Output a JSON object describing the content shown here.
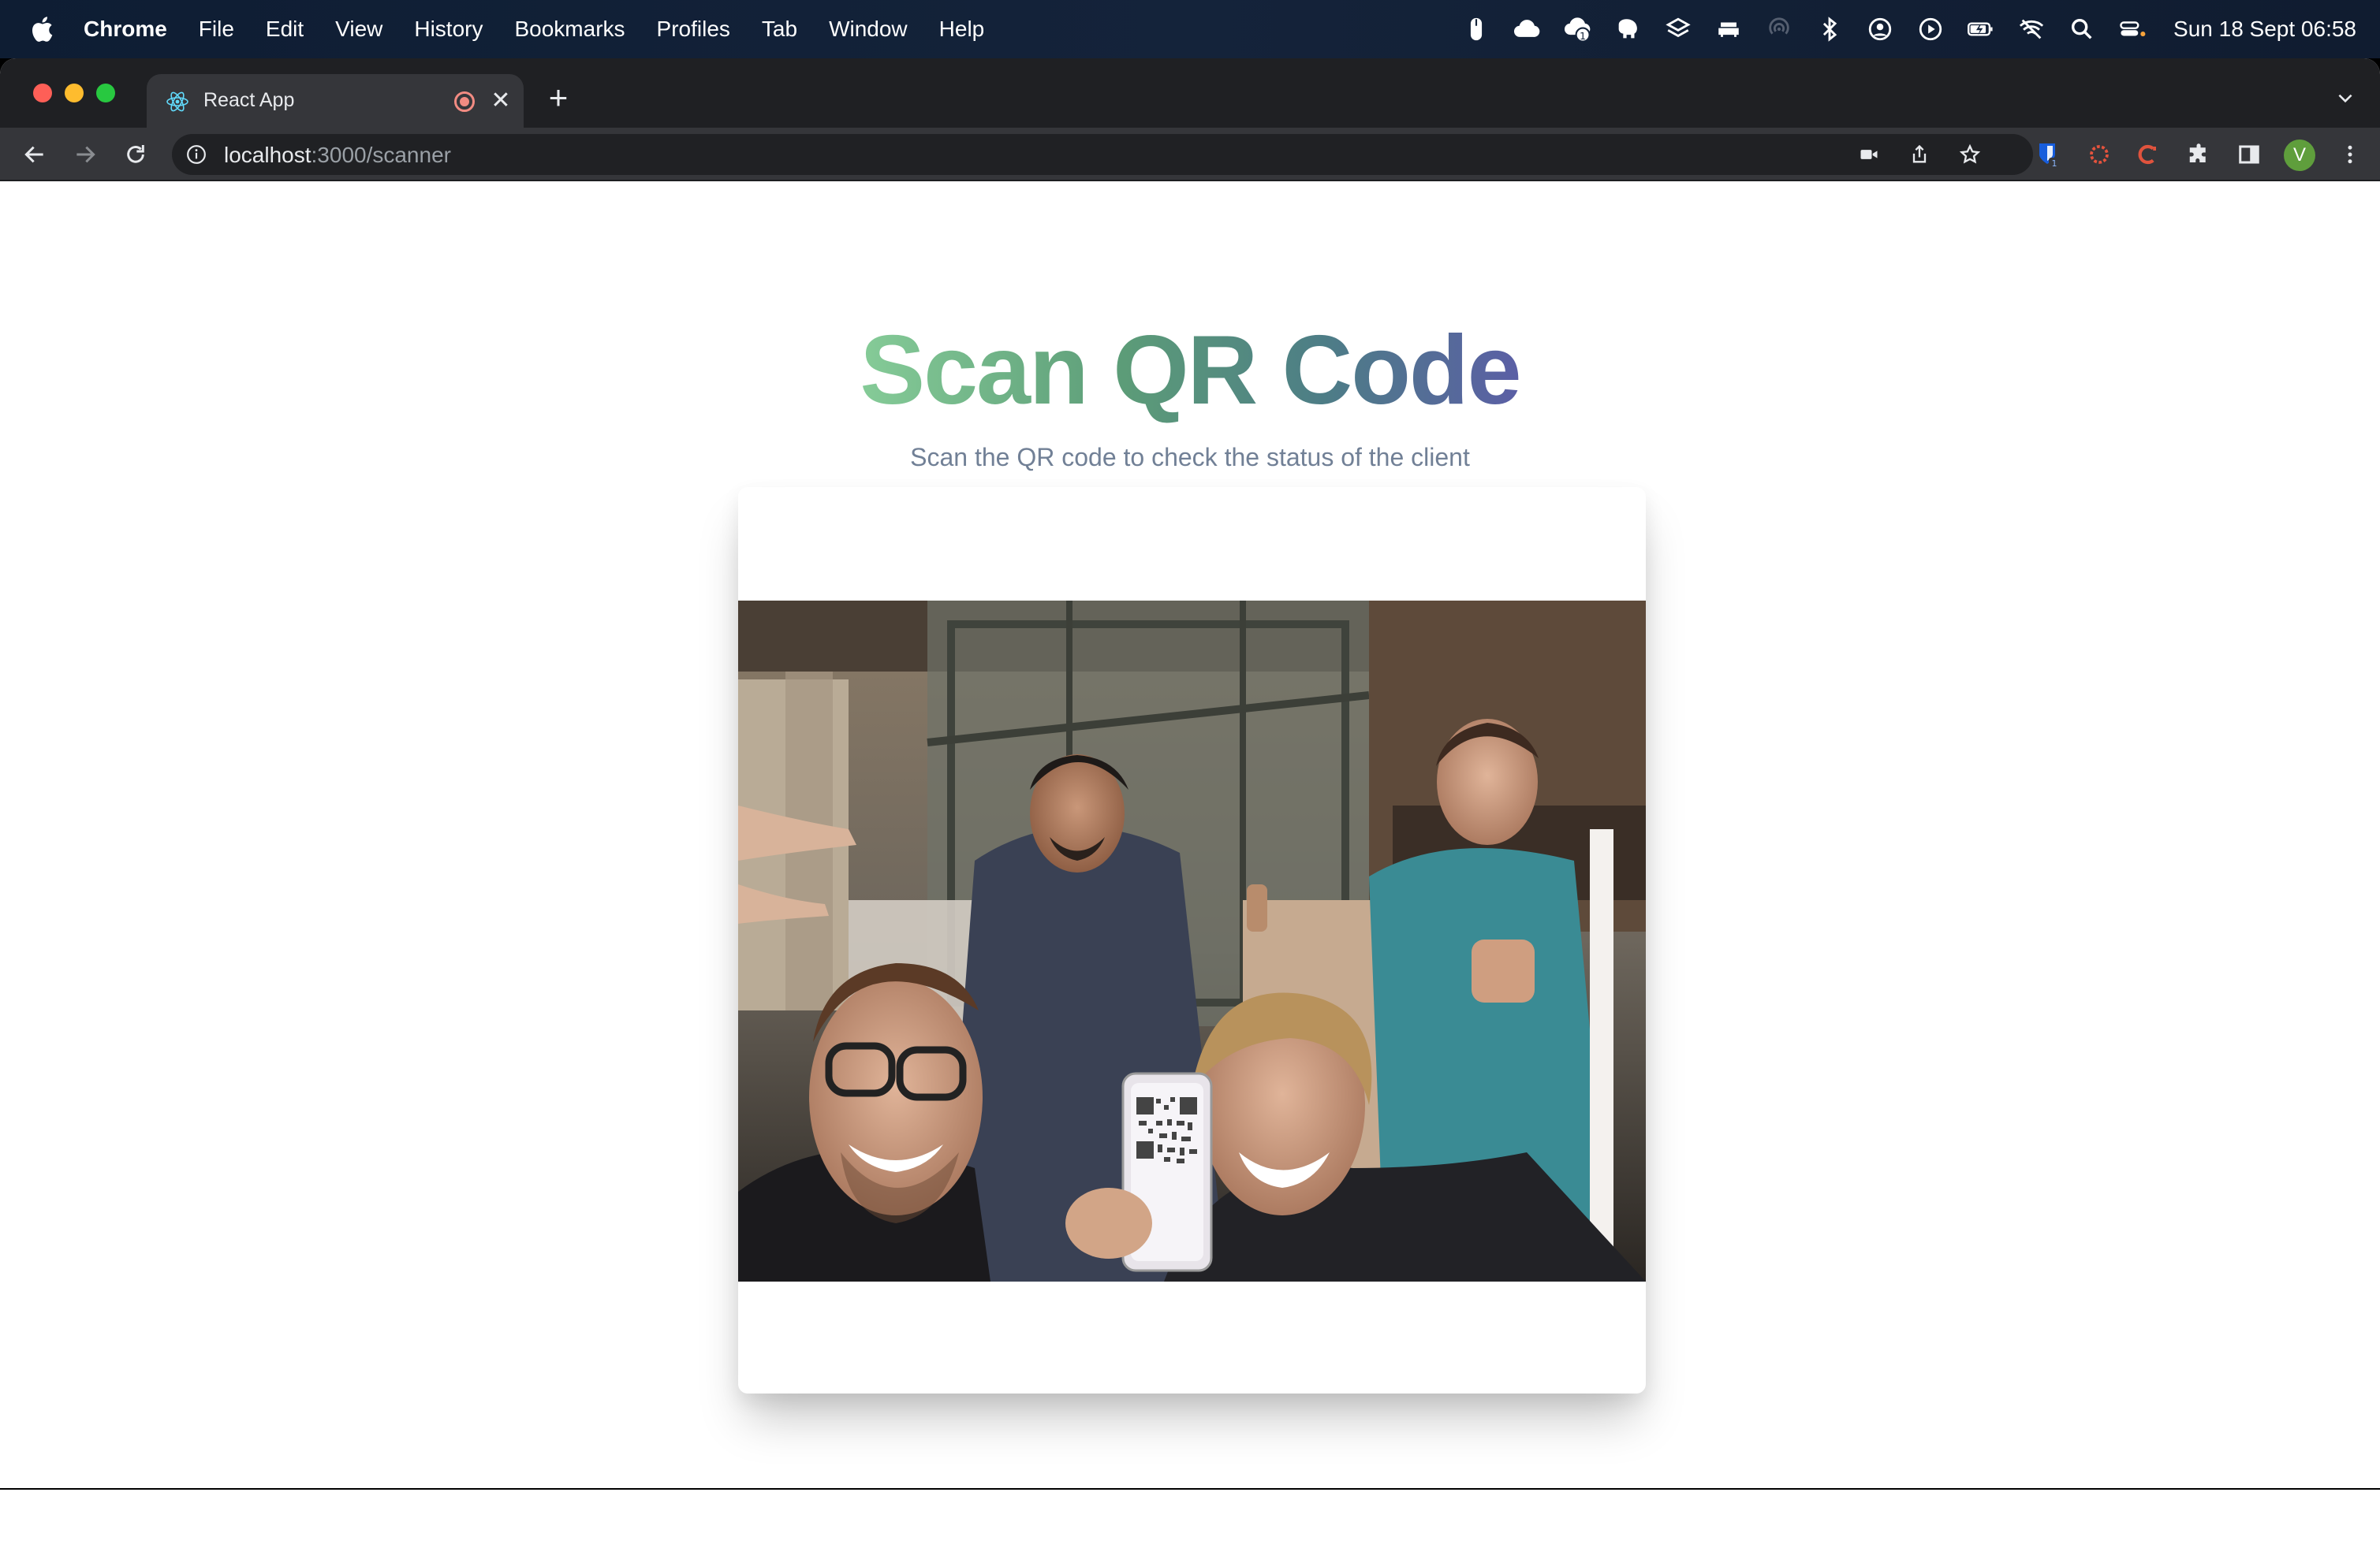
{
  "menubar": {
    "app_name": "Chrome",
    "items": [
      "File",
      "Edit",
      "View",
      "History",
      "Bookmarks",
      "Profiles",
      "Tab",
      "Window",
      "Help"
    ],
    "clock": "Sun 18 Sept  06:58"
  },
  "browser": {
    "tab": {
      "title": "React App",
      "favicon": "react-icon",
      "recording": true
    },
    "address": {
      "host": "localhost",
      "path": ":3000/scanner"
    },
    "profile_initial": "V",
    "extension_badge": "1"
  },
  "page": {
    "title": "Scan QR Code",
    "subtitle": "Scan the QR code to check the status of the client",
    "title_gradient": [
      "#86cc98",
      "#5c9c78",
      "#4d7d86",
      "#5b5ea6"
    ]
  },
  "camera_feed": {
    "description_icon": "camera-feed-image"
  }
}
